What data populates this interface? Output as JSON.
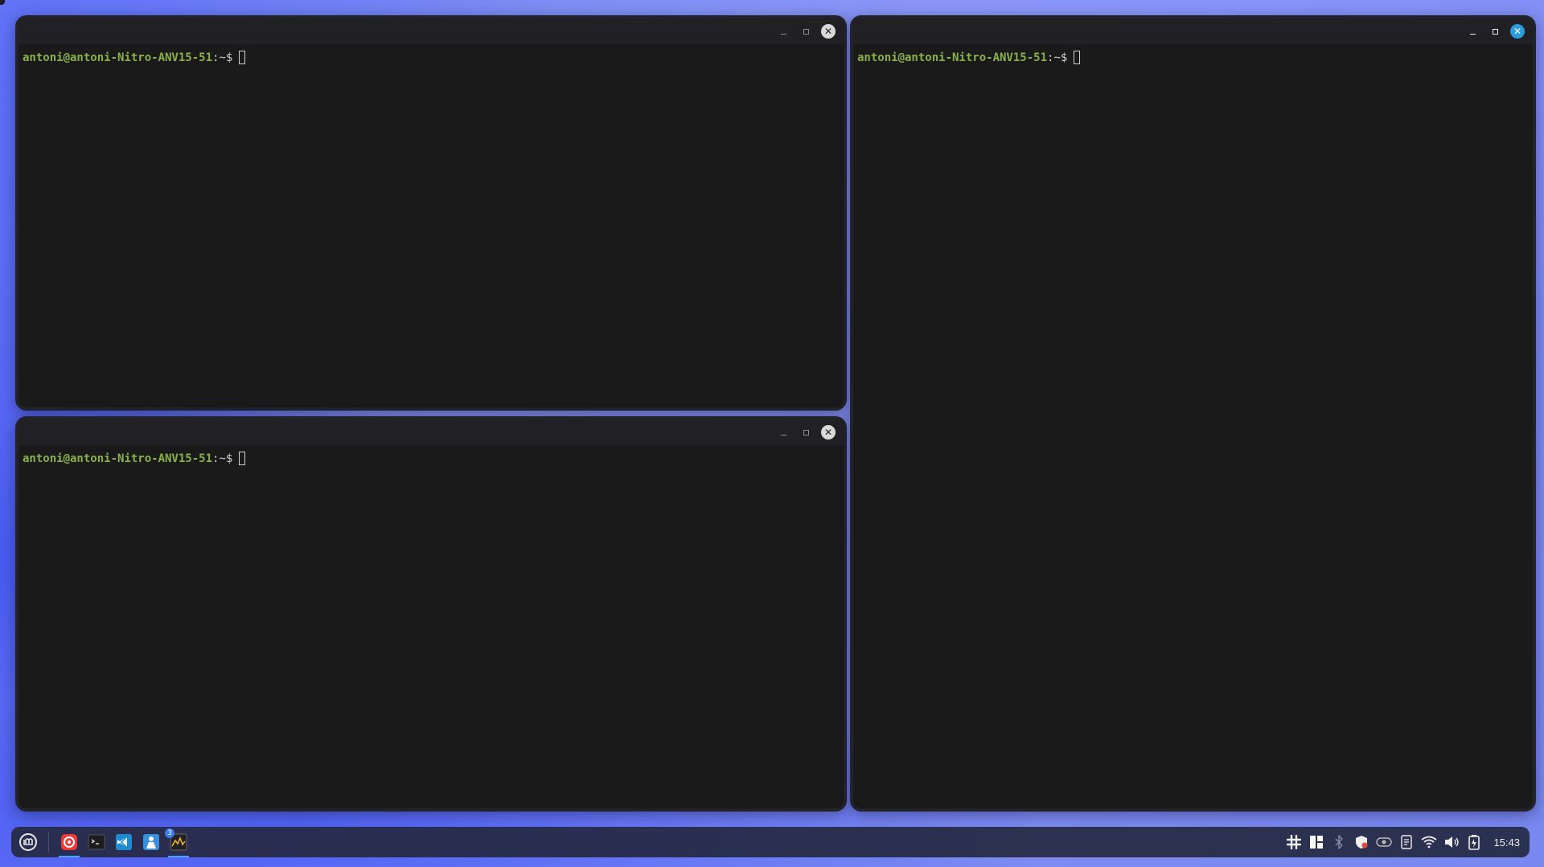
{
  "terminals": {
    "top_left": {
      "prompt_user": "antoni@antoni-Nitro-ANV15-51",
      "prompt_suffix": ":~$"
    },
    "bottom_left": {
      "prompt_user": "antoni@antoni-Nitro-ANV15-51",
      "prompt_suffix": ":~$"
    },
    "right": {
      "prompt_user": "antoni@antoni-Nitro-ANV15-51",
      "prompt_suffix": ":~$"
    }
  },
  "window_controls": {
    "minimize": "–",
    "maximize": "□",
    "close": "✕"
  },
  "taskbar": {
    "apps": [
      {
        "name": "menu",
        "icon": "mint-menu-icon"
      },
      {
        "name": "vivaldi",
        "icon": "vivaldi-icon"
      },
      {
        "name": "terminal",
        "icon": "terminal-icon"
      },
      {
        "name": "vscode",
        "icon": "vscode-icon"
      },
      {
        "name": "software-manager",
        "icon": "software-manager-icon"
      },
      {
        "name": "system-monitor",
        "icon": "system-monitor-icon",
        "badge": "3"
      }
    ],
    "tray": [
      "slack-icon",
      "workspace-icon",
      "bluetooth-icon",
      "security-icon",
      "nvidia-icon",
      "notes-icon",
      "wifi-icon",
      "volume-icon",
      "battery-icon"
    ],
    "clock": "15:43"
  },
  "colors": {
    "prompt_green": "#8ab04a",
    "terminal_bg": "#1a1a1a",
    "active_close": "#2e9bdc"
  }
}
